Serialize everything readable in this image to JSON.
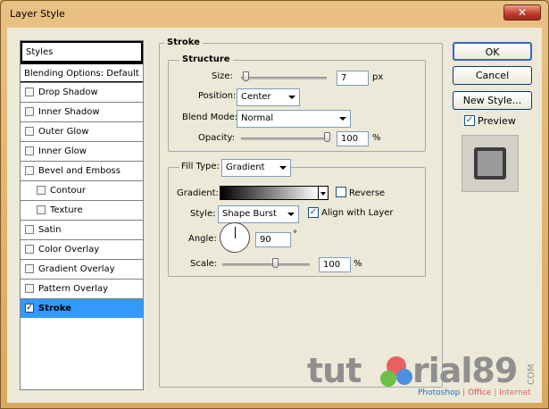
{
  "window": {
    "title": "Layer Style",
    "close_glyph": "✕"
  },
  "styles_list": {
    "header": "Styles",
    "blending": "Blending Options: Default",
    "items": [
      {
        "label": "Drop Shadow",
        "checked": false,
        "sub": false,
        "selected": false
      },
      {
        "label": "Inner Shadow",
        "checked": false,
        "sub": false,
        "selected": false
      },
      {
        "label": "Outer Glow",
        "checked": false,
        "sub": false,
        "selected": false
      },
      {
        "label": "Inner Glow",
        "checked": false,
        "sub": false,
        "selected": false
      },
      {
        "label": "Bevel and Emboss",
        "checked": false,
        "sub": false,
        "selected": false
      },
      {
        "label": "Contour",
        "checked": false,
        "sub": true,
        "selected": false
      },
      {
        "label": "Texture",
        "checked": false,
        "sub": true,
        "selected": false
      },
      {
        "label": "Satin",
        "checked": false,
        "sub": false,
        "selected": false
      },
      {
        "label": "Color Overlay",
        "checked": false,
        "sub": false,
        "selected": false
      },
      {
        "label": "Gradient Overlay",
        "checked": false,
        "sub": false,
        "selected": false
      },
      {
        "label": "Pattern Overlay",
        "checked": false,
        "sub": false,
        "selected": false
      },
      {
        "label": "Stroke",
        "checked": true,
        "sub": false,
        "selected": true
      }
    ]
  },
  "stroke": {
    "title": "Stroke",
    "structure": {
      "title": "Structure",
      "size_label": "Size:",
      "size_value": "7",
      "size_unit": "px",
      "position_label": "Position:",
      "position_value": "Center",
      "blend_label": "Blend Mode:",
      "blend_value": "Normal",
      "opacity_label": "Opacity:",
      "opacity_value": "100",
      "opacity_unit": "%"
    },
    "fill": {
      "label": "Fill Type:",
      "value": "Gradient",
      "gradient_label": "Gradient:",
      "reverse_label": "Reverse",
      "reverse_checked": false,
      "style_label": "Style:",
      "style_value": "Shape Burst",
      "align_label": "Align with Layer",
      "align_checked": true,
      "angle_label": "Angle:",
      "angle_value": "90",
      "angle_unit": "°",
      "scale_label": "Scale:",
      "scale_value": "100",
      "scale_unit": "%"
    }
  },
  "buttons": {
    "ok": "OK",
    "cancel": "Cancel",
    "new_style": "New Style...",
    "preview_label": "Preview",
    "preview_checked": true
  },
  "watermark": {
    "text_before": "tut",
    "text_after": "rial89",
    "com": "COM",
    "photoshop": "Photoshop",
    "sep1": " | ",
    "office": "Office",
    "sep2": " | ",
    "internet": "Internet"
  },
  "check_glyph": "✓",
  "colors": {
    "selected_bg": "#3399ff",
    "dialog_bg": "#ece9d8",
    "frame": "#d9a85e"
  }
}
